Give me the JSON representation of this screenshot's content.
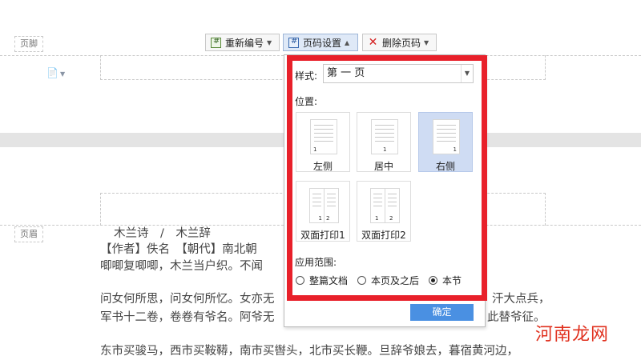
{
  "toolbar": {
    "renumber_label": "重新编号",
    "page_setup_label": "页码设置",
    "delete_label": "删除页码"
  },
  "page": {
    "footer_tag": "页脚",
    "header_tag": "页眉"
  },
  "panel": {
    "style_label": "样式:",
    "style_value": "第 一 页",
    "position_label": "位置:",
    "positions": [
      {
        "label": "左侧",
        "selected": false
      },
      {
        "label": "居中",
        "selected": false
      },
      {
        "label": "右侧",
        "selected": true
      },
      {
        "label": "双面打印1",
        "selected": false
      },
      {
        "label": "双面打印2",
        "selected": false
      }
    ],
    "thumb_numbers": {
      "single": "1",
      "dual_left": "1",
      "dual_right": "2"
    },
    "scope_label": "应用范围:",
    "scope_options": [
      {
        "label": "整篇文档",
        "checked": false
      },
      {
        "label": "本页及之后",
        "checked": false
      },
      {
        "label": "本节",
        "checked": true
      }
    ],
    "ok_label": "确定"
  },
  "document": {
    "title": "木兰诗　/　木兰辞",
    "line1": "【作者】佚名　【朝代】南北朝",
    "line2": "唧唧复唧唧，木兰当户织。不闻",
    "line3_left": "问女何所思，问女何所忆。女亦无",
    "line3_right": "汗大点兵，",
    "line4_left": "军书十二卷，卷卷有爷名。阿爷无",
    "line4_right": "此替爷征。",
    "line5": "东市买骏马，西市买鞍鞯，南市买辔头，北市买长鞭。旦辞爷娘去，暮宿黄河边，"
  },
  "watermark": "河南龙网",
  "colors": {
    "highlight_frame": "#e8202a",
    "ok_button": "#4a90e2",
    "selected_option": "#cfdcf3"
  }
}
